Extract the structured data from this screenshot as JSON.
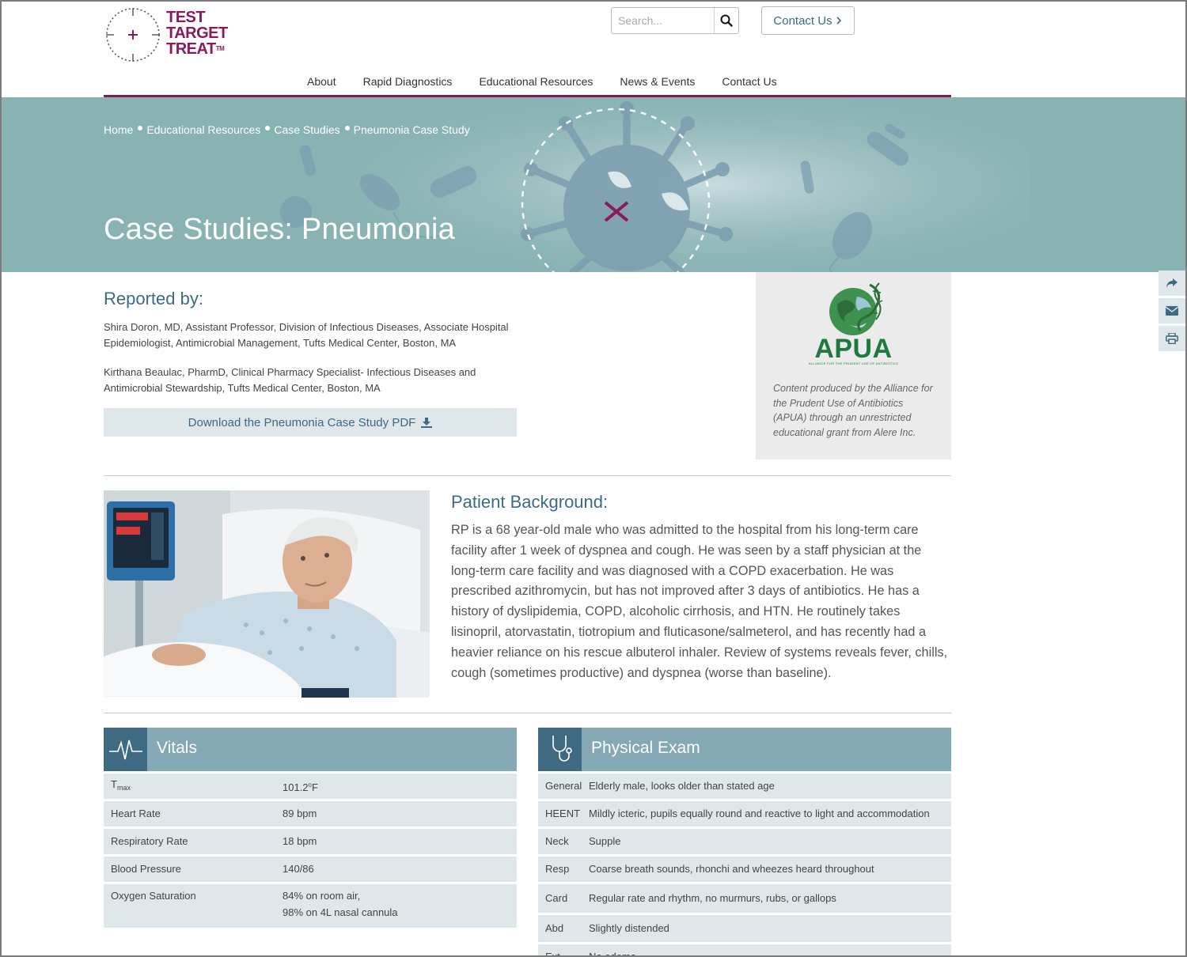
{
  "header": {
    "logo": {
      "line1": "TEST",
      "line2": "TARGET",
      "line3": "TREAT",
      "tm": "TM"
    },
    "search": {
      "placeholder": "Search...",
      "value": ""
    },
    "contact_button": "Contact Us",
    "nav": [
      "About",
      "Rapid Diagnostics",
      "Educational Resources",
      "News & Events",
      "Contact Us"
    ]
  },
  "hero": {
    "breadcrumb": [
      "Home",
      "Educational Resources",
      "Case Studies",
      "Pneumonia Case Study"
    ],
    "title": "Case Studies: Pneumonia"
  },
  "reported": {
    "title": "Reported by:",
    "authors": [
      "Shira Doron, MD, Assistant Professor, Division of Infectious Diseases, Associate Hospital Epidemiologist, Antimicrobial Management, Tufts Medical Center, Boston, MA",
      "Kirthana Beaulac, PharmD, Clinical Pharmacy Specialist- Infectious Diseases and Antimicrobial Stewardship, Tufts Medical Center, Boston, MA"
    ],
    "download_label": "Download the Pneumonia Case Study PDF"
  },
  "apua": {
    "logo_word": "APUA",
    "tagline": "ALLIANCE FOR THE PRUDENT USE OF ANTIBIOTICS",
    "text": "Content produced by the Alliance for the Prudent Use of Antibiotics (APUA) through an unrestricted educational grant from Alere Inc."
  },
  "patient": {
    "title": "Patient Background:",
    "text": "RP is a 68 year-old male who was admitted to the hospital from his long-term care facility after 1 week of dyspnea and cough. He was seen by a staff physician at the long-term care facility and was diagnosed with a COPD exacerbation. He was prescribed azithromycin, but has not improved after 3 days of antibiotics. He has a history of dyslipidemia, COPD, alcoholic cirrhosis, and HTN. He routinely takes lisinopril, atorvastatin, tiotropium and fluticasone/salmeterol, and has recently had a heavier reliance on his rescue albuterol inhaler. Review of systems reveals fever, chills, cough (sometimes productive) and dyspnea (worse than baseline)."
  },
  "vitals": {
    "title": "Vitals",
    "tmax_label": "T",
    "tmax_sub": "max",
    "tmax_value": "101.2",
    "tmax_unit_sup": "o",
    "tmax_unit": "F",
    "rows": [
      {
        "label": "Heart Rate",
        "value": "89 bpm"
      },
      {
        "label": "Respiratory Rate",
        "value": "18 bpm"
      },
      {
        "label": "Blood Pressure",
        "value": "140/86"
      }
    ],
    "oxygen": {
      "label": "Oxygen Saturation",
      "value1": "84% on room air,",
      "value2": "98% on 4L nasal cannula"
    }
  },
  "exam": {
    "title": "Physical Exam",
    "rows": [
      {
        "label": "General",
        "value": "Elderly male, looks older than stated age"
      },
      {
        "label": "HEENT",
        "value": "Mildly icteric, pupils equally round and reactive to light and accommodation"
      },
      {
        "label": "Neck",
        "value": "Supple"
      },
      {
        "label": "Resp",
        "value": "Coarse breath sounds, rhonchi and wheezes heard throughout"
      },
      {
        "label": "Card",
        "value": "Regular rate and rhythm, no murmurs, rubs, or gallops"
      },
      {
        "label": "Abd",
        "value": "Slightly distended"
      },
      {
        "label": "Ext",
        "value": "No edema"
      }
    ]
  },
  "colors": {
    "brand": "#8a1a5c",
    "accent": "#3d6a86",
    "hero": "#89b2b3",
    "row": "#dfe7ea"
  }
}
